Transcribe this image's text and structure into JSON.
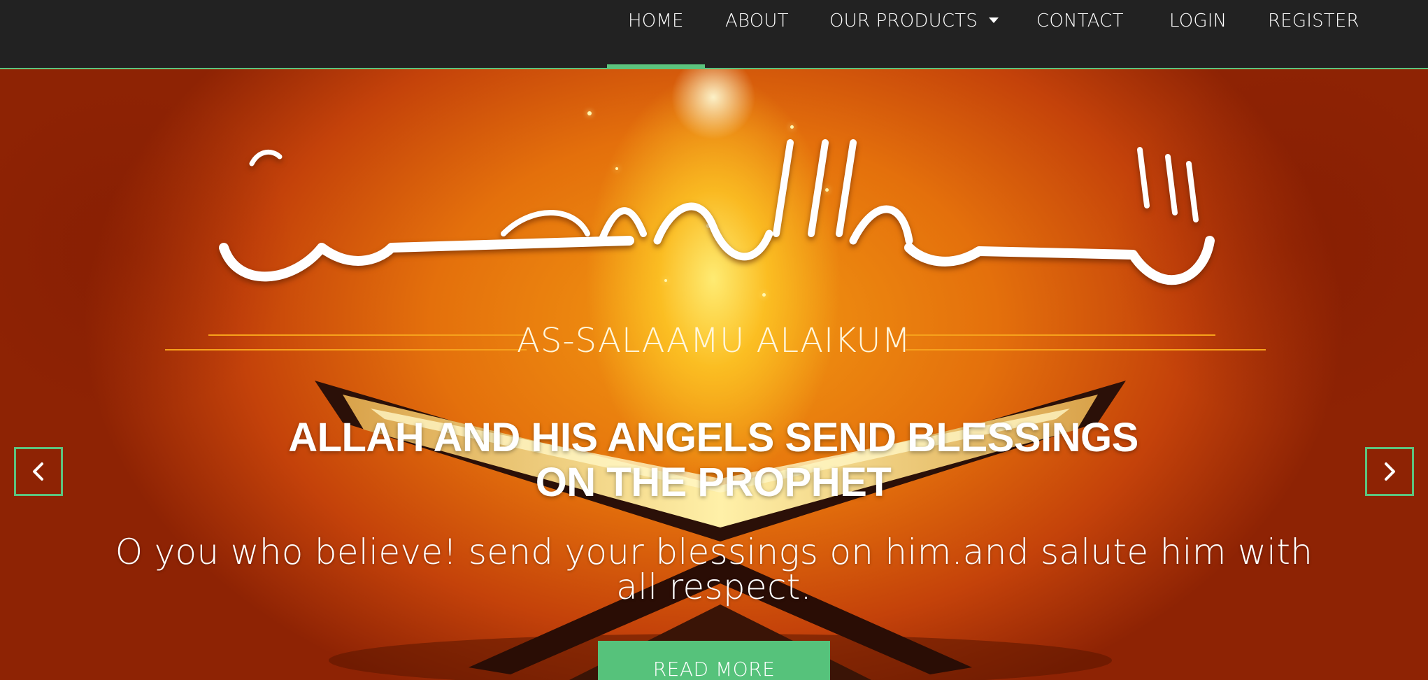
{
  "nav": {
    "items": [
      {
        "label": "HOME",
        "active": true
      },
      {
        "label": "ABOUT"
      },
      {
        "label": "OUR PRODUCTS",
        "dropdown": true
      },
      {
        "label": "CONTACT"
      },
      {
        "label": "LOGIN"
      },
      {
        "label": "REGISTER"
      }
    ]
  },
  "hero": {
    "greeting": "AS-SALAAMU ALAIKUM",
    "headline": "ALLAH AND HIS ANGELS SEND BLESSINGS ON THE PROPHET",
    "subtext": "O you who believe! send your blessings on him.and salute him with all respect.",
    "button_label": "READ MORE",
    "prev_icon": "chevron-left-icon",
    "next_icon": "chevron-right-icon"
  },
  "colors": {
    "navbar_bg": "#222222",
    "accent": "#5cc47e",
    "button_bg": "#56c27b",
    "divider": "#f7a21c"
  }
}
